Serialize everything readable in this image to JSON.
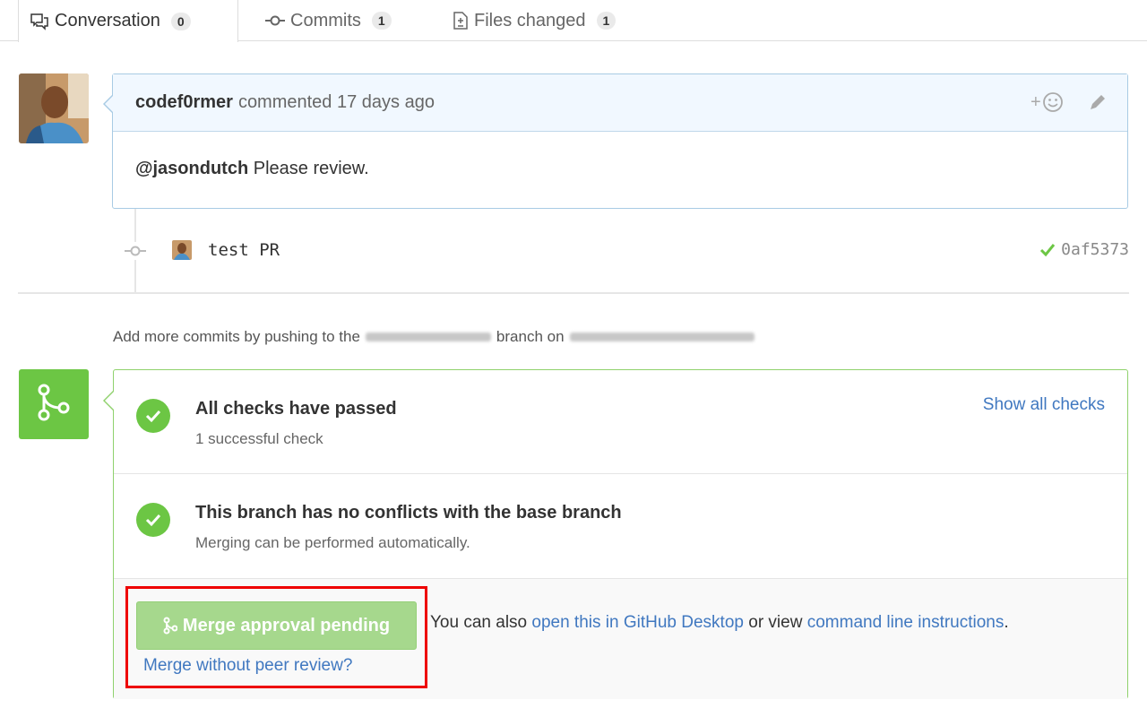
{
  "tabs": [
    {
      "label": "Conversation",
      "count": "0",
      "icon": "comment-discussion-icon"
    },
    {
      "label": "Commits",
      "count": "1",
      "icon": "git-commit-icon"
    },
    {
      "label": "Files changed",
      "count": "1",
      "icon": "diff-icon"
    }
  ],
  "comment": {
    "author": "codef0rmer",
    "meta": "commented 17 days ago",
    "mention": "@jasondutch",
    "body": "Please review."
  },
  "commit": {
    "message": "test PR",
    "sha": "0af5373"
  },
  "push_info": {
    "prefix": "Add more commits by pushing to the",
    "middle": "branch on"
  },
  "checks": {
    "title": "All checks have passed",
    "subtitle": "1 successful check",
    "show_all": "Show all checks"
  },
  "conflicts": {
    "title": "This branch has no conflicts with the base branch",
    "subtitle": "Merging can be performed automatically."
  },
  "merge": {
    "button_label": "Merge approval pending",
    "no_review_link": "Merge without peer review?",
    "also_prefix": "You can also",
    "desktop_link": "open this in GitHub Desktop",
    "or_view": "or view",
    "cli_link": "command line instructions",
    "period": "."
  },
  "colors": {
    "success_green": "#6cc644",
    "link_blue": "#4078c0",
    "highlight_red": "#ee0000"
  }
}
